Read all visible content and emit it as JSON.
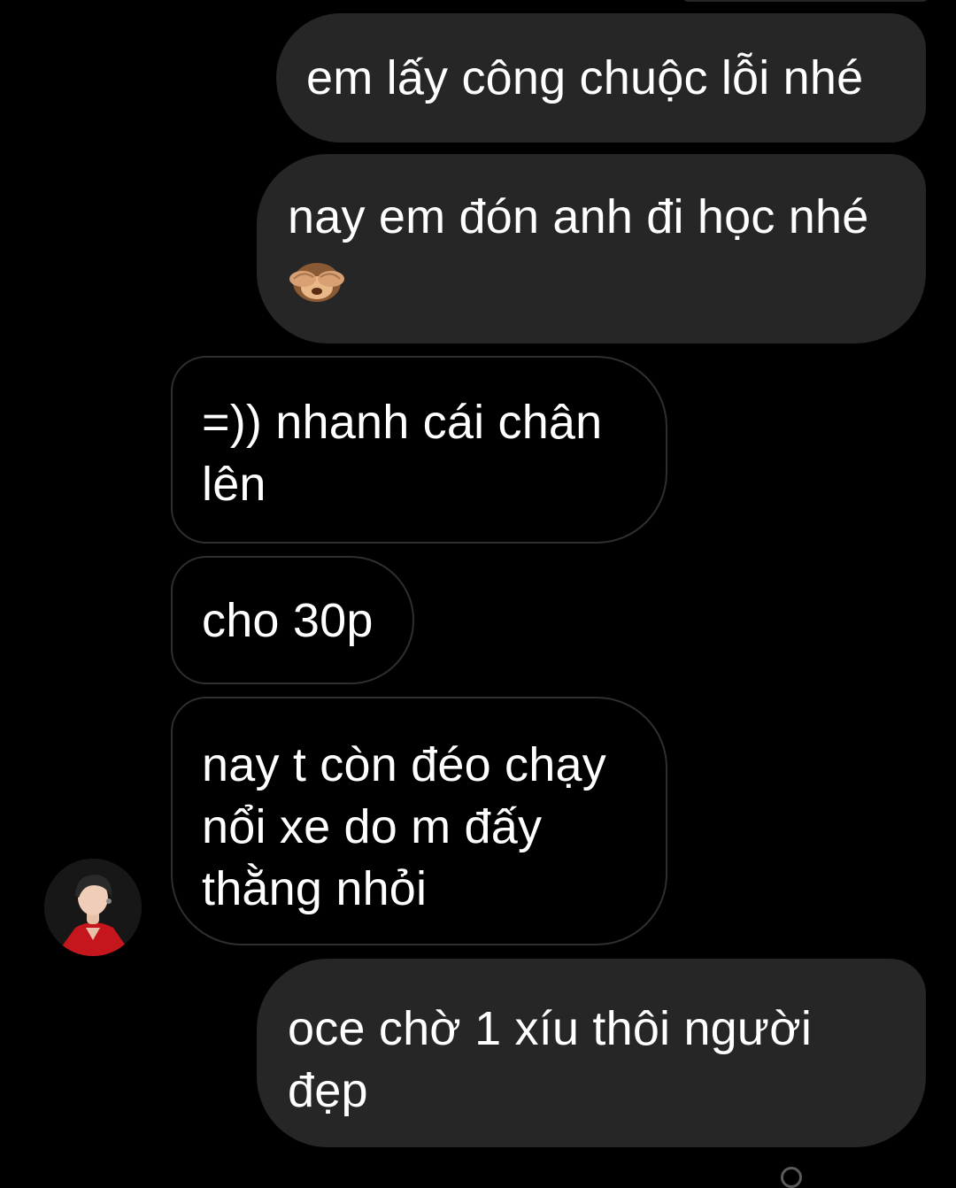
{
  "messages": [
    {
      "direction": "sent",
      "text": "em lấy công chuộc lỗi nhé"
    },
    {
      "direction": "sent",
      "text": "nay em đón anh đi học nhé",
      "emoji": "see-no-evil-monkey"
    },
    {
      "direction": "received",
      "text": "=)) nhanh cái chân lên"
    },
    {
      "direction": "received",
      "text": "cho 30p"
    },
    {
      "direction": "received",
      "text": "nay t còn đéo chạy nổi xe do m đấy thằng nhỏi"
    },
    {
      "direction": "sent",
      "text": "oce chờ 1 xíu thôi người đẹp"
    }
  ],
  "contact": {
    "avatar_icon": "profile-photo-red-jacket"
  },
  "colors": {
    "background": "#000000",
    "sent_bubble": "#262626",
    "received_border": "#2f2f2f",
    "text": "#ffffff"
  }
}
